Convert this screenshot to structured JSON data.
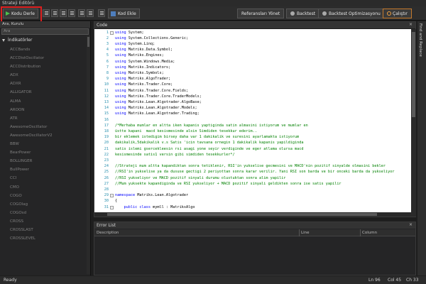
{
  "window": {
    "title": "Strateji Editörü"
  },
  "toolbar": {
    "compile_label": "Kodu Derle",
    "codegen_label": "Kod Ekle",
    "references_label": "Referansları Yönet",
    "backtest_label": "Backtest",
    "backtest_opt_label": "Backtest Optimizasyonu",
    "run_label": "Çalıştır"
  },
  "left_panel": {
    "header": "Ara, Kurulu",
    "search_placeholder": "Ara",
    "group_label": "İndikatörler",
    "items": [
      "ACCBands",
      "ACCDistOscillator",
      "ACCDistribution",
      "ADX",
      "ADXR",
      "ALLIGATOR",
      "ALMA",
      "AROON",
      "ATR",
      "AwesomeOscillator",
      "AwesomeOscillatorV2",
      "BBW",
      "BearPower",
      "BOLLINGER",
      "BullPower",
      "CCI",
      "CMO",
      "COGO",
      "COGOlag",
      "COGOsd",
      "CROSS",
      "CROSSLAST",
      "CROSSLEVEL"
    ]
  },
  "code_panel": {
    "title": "Code",
    "lines": [
      {
        "n": "1",
        "fold": "-",
        "parts": [
          [
            "kw",
            "using"
          ],
          [
            "",
            "System;"
          ]
        ]
      },
      {
        "n": "2",
        "parts": [
          [
            "kw",
            "using"
          ],
          [
            "",
            "System.Collections.Generic;"
          ]
        ]
      },
      {
        "n": "3",
        "parts": [
          [
            "kw",
            "using"
          ],
          [
            "",
            "System.Linq;"
          ]
        ]
      },
      {
        "n": "4",
        "parts": [
          [
            "kw",
            "using"
          ],
          [
            "",
            "Matriks.Data.Symbol;"
          ]
        ]
      },
      {
        "n": "5",
        "parts": [
          [
            "kw",
            "using"
          ],
          [
            "",
            "Matriks.Engines;"
          ]
        ]
      },
      {
        "n": "6",
        "parts": [
          [
            "kw",
            "using"
          ],
          [
            "",
            "System.Windows.Media;"
          ]
        ]
      },
      {
        "n": "7",
        "parts": [
          [
            "kw",
            "using"
          ],
          [
            "",
            "Matriks.Indicators;"
          ]
        ]
      },
      {
        "n": "8",
        "parts": [
          [
            "kw",
            "using"
          ],
          [
            "",
            "Matriks.Symbols;"
          ]
        ]
      },
      {
        "n": "9",
        "parts": [
          [
            "kw",
            "using"
          ],
          [
            "",
            "Matriks.AlgoTrader;"
          ]
        ]
      },
      {
        "n": "10",
        "parts": [
          [
            "kw",
            "using"
          ],
          [
            "",
            "Matriks.Trader.Core;"
          ]
        ]
      },
      {
        "n": "11",
        "parts": [
          [
            "kw",
            "using"
          ],
          [
            "",
            "Matriks.Trader.Core.Fields;"
          ]
        ]
      },
      {
        "n": "12",
        "parts": [
          [
            "kw",
            "using"
          ],
          [
            "",
            "Matriks.Trader.Core.TraderModels;"
          ]
        ]
      },
      {
        "n": "13",
        "parts": [
          [
            "kw",
            "using"
          ],
          [
            "",
            "Matriks.Lean.Algotrader.AlgoBase;"
          ]
        ]
      },
      {
        "n": "14",
        "parts": [
          [
            "kw",
            "using"
          ],
          [
            "",
            "Matriks.Lean.Algotrader.Models;"
          ]
        ]
      },
      {
        "n": "15",
        "parts": [
          [
            "kw",
            "using"
          ],
          [
            "",
            "Matriks.Lean.Algotrader.Trading;"
          ]
        ]
      },
      {
        "n": "16",
        "parts": []
      },
      {
        "n": "17",
        "parts": [
          [
            "cm",
            "/*Merhaba mumlar en altta iken kapanis yaptiginda satin almasini istiyorum ve mumlar en"
          ]
        ]
      },
      {
        "n": "18",
        "parts": [
          [
            "cm",
            "üstte kapani  macd kesismesinde alsin Simdiden tesekkur ederim.."
          ]
        ]
      },
      {
        "n": "19",
        "parts": [
          [
            "cm",
            "bir eklemek istedigim birsey daha var 1 dakikalik ve suresini ayarlamakta istiyorum"
          ]
        ]
      },
      {
        "n": "20",
        "parts": [
          [
            "cm",
            "dakikalik,5dakikalik v.s Satis 'icin tavsana ornegin 1 dakikalik kapanis yapildiginda"
          ]
        ]
      },
      {
        "n": "21",
        "parts": [
          [
            "cm",
            "satis islemi gsercekleesin rsi asagi yone seyir verdiginde ve eger atlama olursa macd"
          ]
        ]
      },
      {
        "n": "22",
        "parts": [
          [
            "cm",
            "kesismesinde satis1 versin gibi simdiden tesekkurler*/"
          ]
        ]
      },
      {
        "n": "23",
        "parts": []
      },
      {
        "n": "24",
        "parts": [
          [
            "cm",
            "//Strateji mum altta kapandiktan sonra tetiklenir, RSI'in yukselise gecmesini ve MACD'nin pozitif sinyalde olmasini bekler"
          ]
        ]
      },
      {
        "n": "25",
        "parts": [
          [
            "cm",
            "//RSI'in yukselise ya da dususe gectigi 2 periyottan sonra karar verilir. Yani RSI son barda ve bir onceki barda da yukseliyor"
          ]
        ]
      },
      {
        "n": "26",
        "parts": [
          [
            "cm",
            "//RSI yukseliyor ve MACD pozitif sinyali durumu olustuktan sonra alim yapilir"
          ]
        ]
      },
      {
        "n": "27",
        "parts": [
          [
            "cm",
            "//Mum yuksekte kapandiginda ve RSI yukseliyor + MACD pozitif sinyali geldikten sonra ise satis yapilir"
          ]
        ]
      },
      {
        "n": "28",
        "parts": []
      },
      {
        "n": "29",
        "fold": "-",
        "parts": [
          [
            "kw",
            "namespace"
          ],
          [
            "",
            "Matriks.Lean.Algotrader"
          ]
        ]
      },
      {
        "n": "30",
        "parts": [
          [
            "",
            "{"
          ]
        ]
      },
      {
        "n": "31",
        "fold": "-",
        "parts": [
          [
            "kw",
            "    public class"
          ],
          [
            "",
            "mymll : MatriksAlgo"
          ]
        ]
      }
    ]
  },
  "error_panel": {
    "title": "Error List",
    "columns": {
      "description": "Description",
      "line": "Line",
      "column": "Column"
    }
  },
  "right_strip": {
    "label": "Find and Replace"
  },
  "statusbar": {
    "status": "Ready",
    "ln": "Ln 96",
    "col": "Col 45",
    "ch": "Ch 33"
  }
}
